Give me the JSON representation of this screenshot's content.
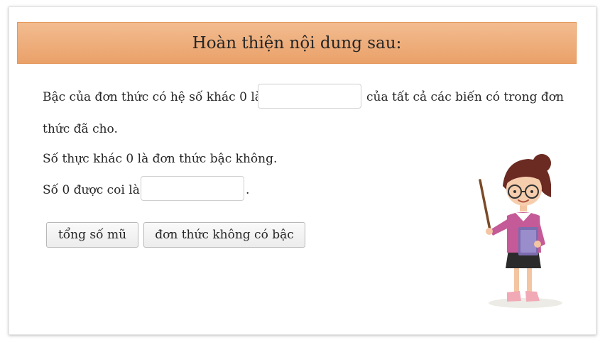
{
  "header": {
    "title": "Hoàn thiện nội dung sau:"
  },
  "content": {
    "sentence1_part1": "Bậc của đơn thức có hệ số khác 0 là",
    "sentence1_part2": "của tất cả các biến có trong đơn",
    "sentence1_part3": "thức đã cho.",
    "sentence2": "Số thực khác 0 là đơn thức bậc không.",
    "sentence3_part1": "Số 0 được coi là",
    "sentence3_part2": ".",
    "blank1_value": "",
    "blank2_value": ""
  },
  "options": [
    {
      "label": "tổng số mũ"
    },
    {
      "label": "đơn thức không có bậc"
    }
  ],
  "colors": {
    "header_bg": "#eeaa74",
    "header_border": "#e5995c",
    "shirt": "#c45a97",
    "book": "#7b6cb0"
  },
  "illustration": {
    "icon": "teacher-with-pointer-icon"
  }
}
